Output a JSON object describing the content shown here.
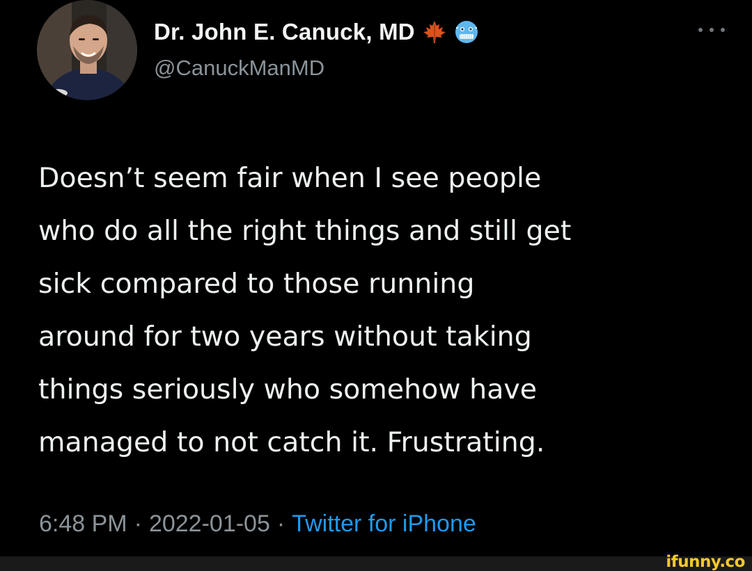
{
  "author": {
    "display_name": "Dr. John E. Canuck, MD",
    "handle": "@CanuckManMD",
    "avatar_icon": "profile-photo-icon",
    "name_emojis": [
      "maple-leaf-icon",
      "cold-face-icon"
    ]
  },
  "more_icon": "more-options-icon",
  "tweet": {
    "lines": [
      "Doesn’t seem fair when I see people",
      "who do all the right things and still get",
      "sick compared to those running",
      "around for two years without taking",
      "things seriously who somehow have",
      "managed to not catch it. Frustrating."
    ]
  },
  "meta": {
    "time": "6:48 PM",
    "separator": "·",
    "date": "2022-01-05",
    "source": "Twitter for iPhone"
  },
  "watermark": "ifunny.co",
  "colors": {
    "background": "#000000",
    "text": "#eef1f2",
    "secondary_text": "#8b9399",
    "link": "#1d9bf0",
    "watermark": "#f4c92b"
  }
}
